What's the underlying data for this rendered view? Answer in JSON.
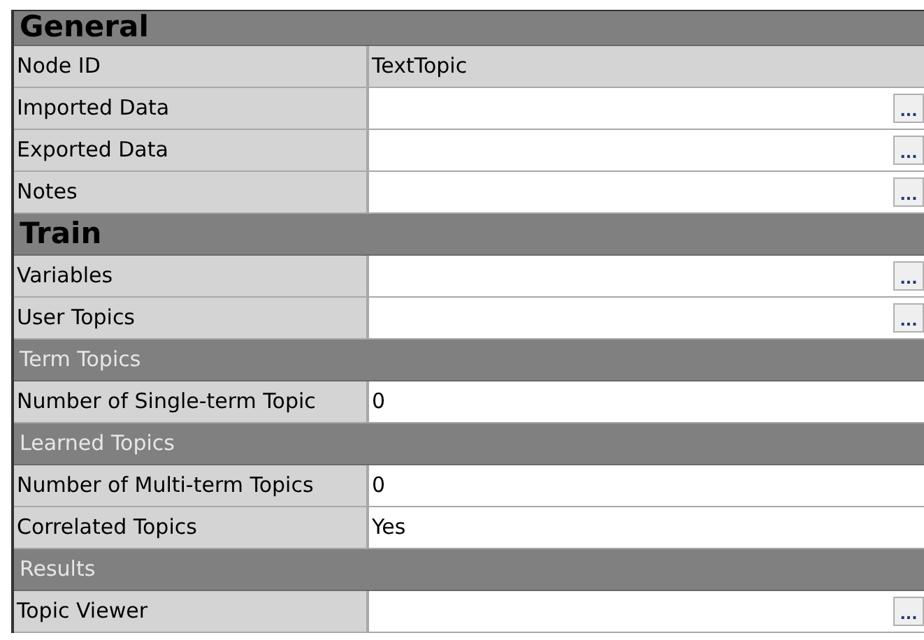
{
  "rows": [
    {
      "kind": "section",
      "label": "General"
    },
    {
      "kind": "property",
      "label": "Node ID",
      "value": "TextTopic",
      "readonly": true
    },
    {
      "kind": "property",
      "label": "Imported Data",
      "readonly": false,
      "button": "..."
    },
    {
      "kind": "property",
      "label": "Exported Data",
      "readonly": false,
      "button": "..."
    },
    {
      "kind": "property",
      "label": "Notes",
      "readonly": false,
      "button": "..."
    },
    {
      "kind": "section",
      "label": "Train"
    },
    {
      "kind": "property",
      "label": "Variables",
      "readonly": false,
      "button": "..."
    },
    {
      "kind": "property",
      "label": "User Topics",
      "readonly": false,
      "button": "..."
    },
    {
      "kind": "group",
      "label": "Term Topics"
    },
    {
      "kind": "property",
      "label": "Number of Single-term Topic",
      "value": "0",
      "readonly": false
    },
    {
      "kind": "group",
      "label": "Learned Topics"
    },
    {
      "kind": "property",
      "label": "Number of Multi-term Topics",
      "value": "0",
      "readonly": false
    },
    {
      "kind": "property",
      "label": "Correlated Topics",
      "value": "Yes",
      "readonly": false
    },
    {
      "kind": "group",
      "label": "Results"
    },
    {
      "kind": "property",
      "label": "Topic Viewer",
      "readonly": false,
      "button": "..."
    }
  ]
}
